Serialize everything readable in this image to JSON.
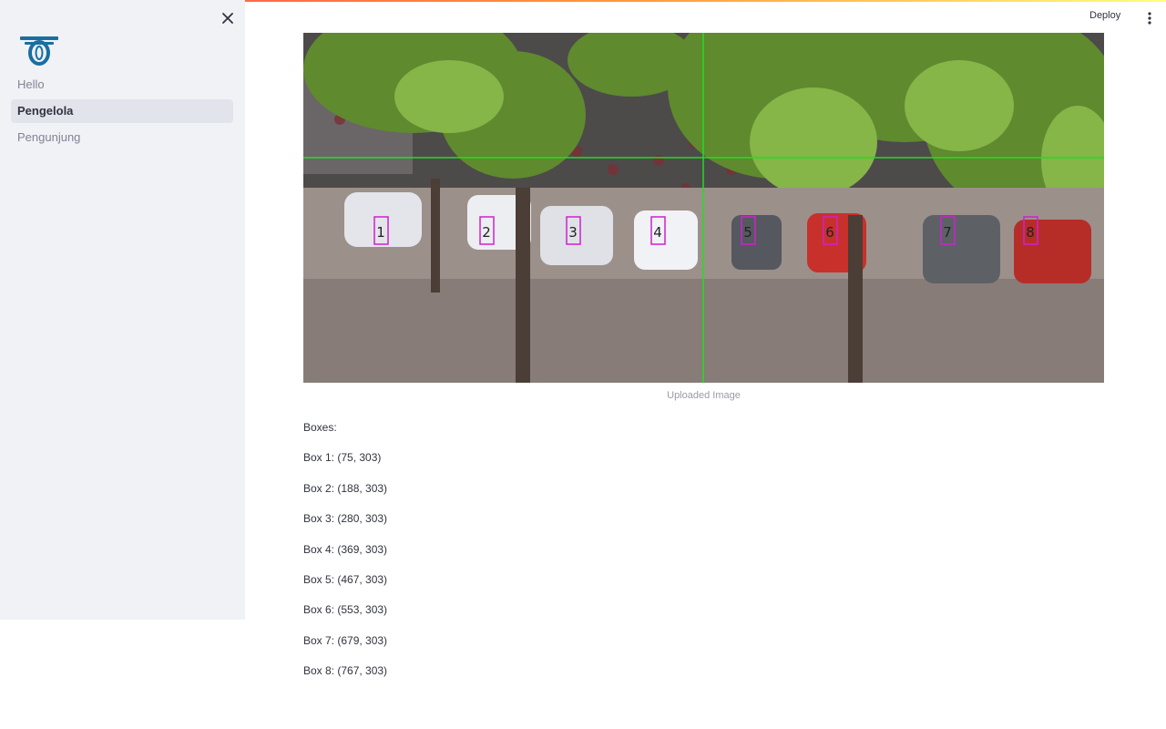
{
  "sidebar": {
    "items": [
      {
        "label": "Hello",
        "active": false
      },
      {
        "label": "Pengelola",
        "active": true
      },
      {
        "label": "Pengunjung",
        "active": false
      }
    ],
    "logo_icon": "logo-icon",
    "close_icon": "close-icon"
  },
  "toolbar": {
    "deploy_label": "Deploy",
    "menu_icon": "more-vertical-icon"
  },
  "main": {
    "image_caption": "Uploaded Image",
    "image_boxes": [
      "1",
      "2",
      "3",
      "4",
      "5",
      "6",
      "7",
      "8"
    ],
    "boxes_heading": "Boxes:",
    "boxes": [
      "Box 1: (75, 303)",
      "Box 2: (188, 303)",
      "Box 3: (280, 303)",
      "Box 4: (369, 303)",
      "Box 5: (467, 303)",
      "Box 6: (553, 303)",
      "Box 7: (679, 303)",
      "Box 8: (767, 303)"
    ]
  },
  "colors": {
    "accent_gradient": [
      "#ff4b4b",
      "#ff9a3c",
      "#fffd80"
    ],
    "sidebar_bg": "#f0f2f6",
    "logo": "#1a6fa0",
    "guide_lines": "#22dd22",
    "box_outline": "#d020d0"
  }
}
